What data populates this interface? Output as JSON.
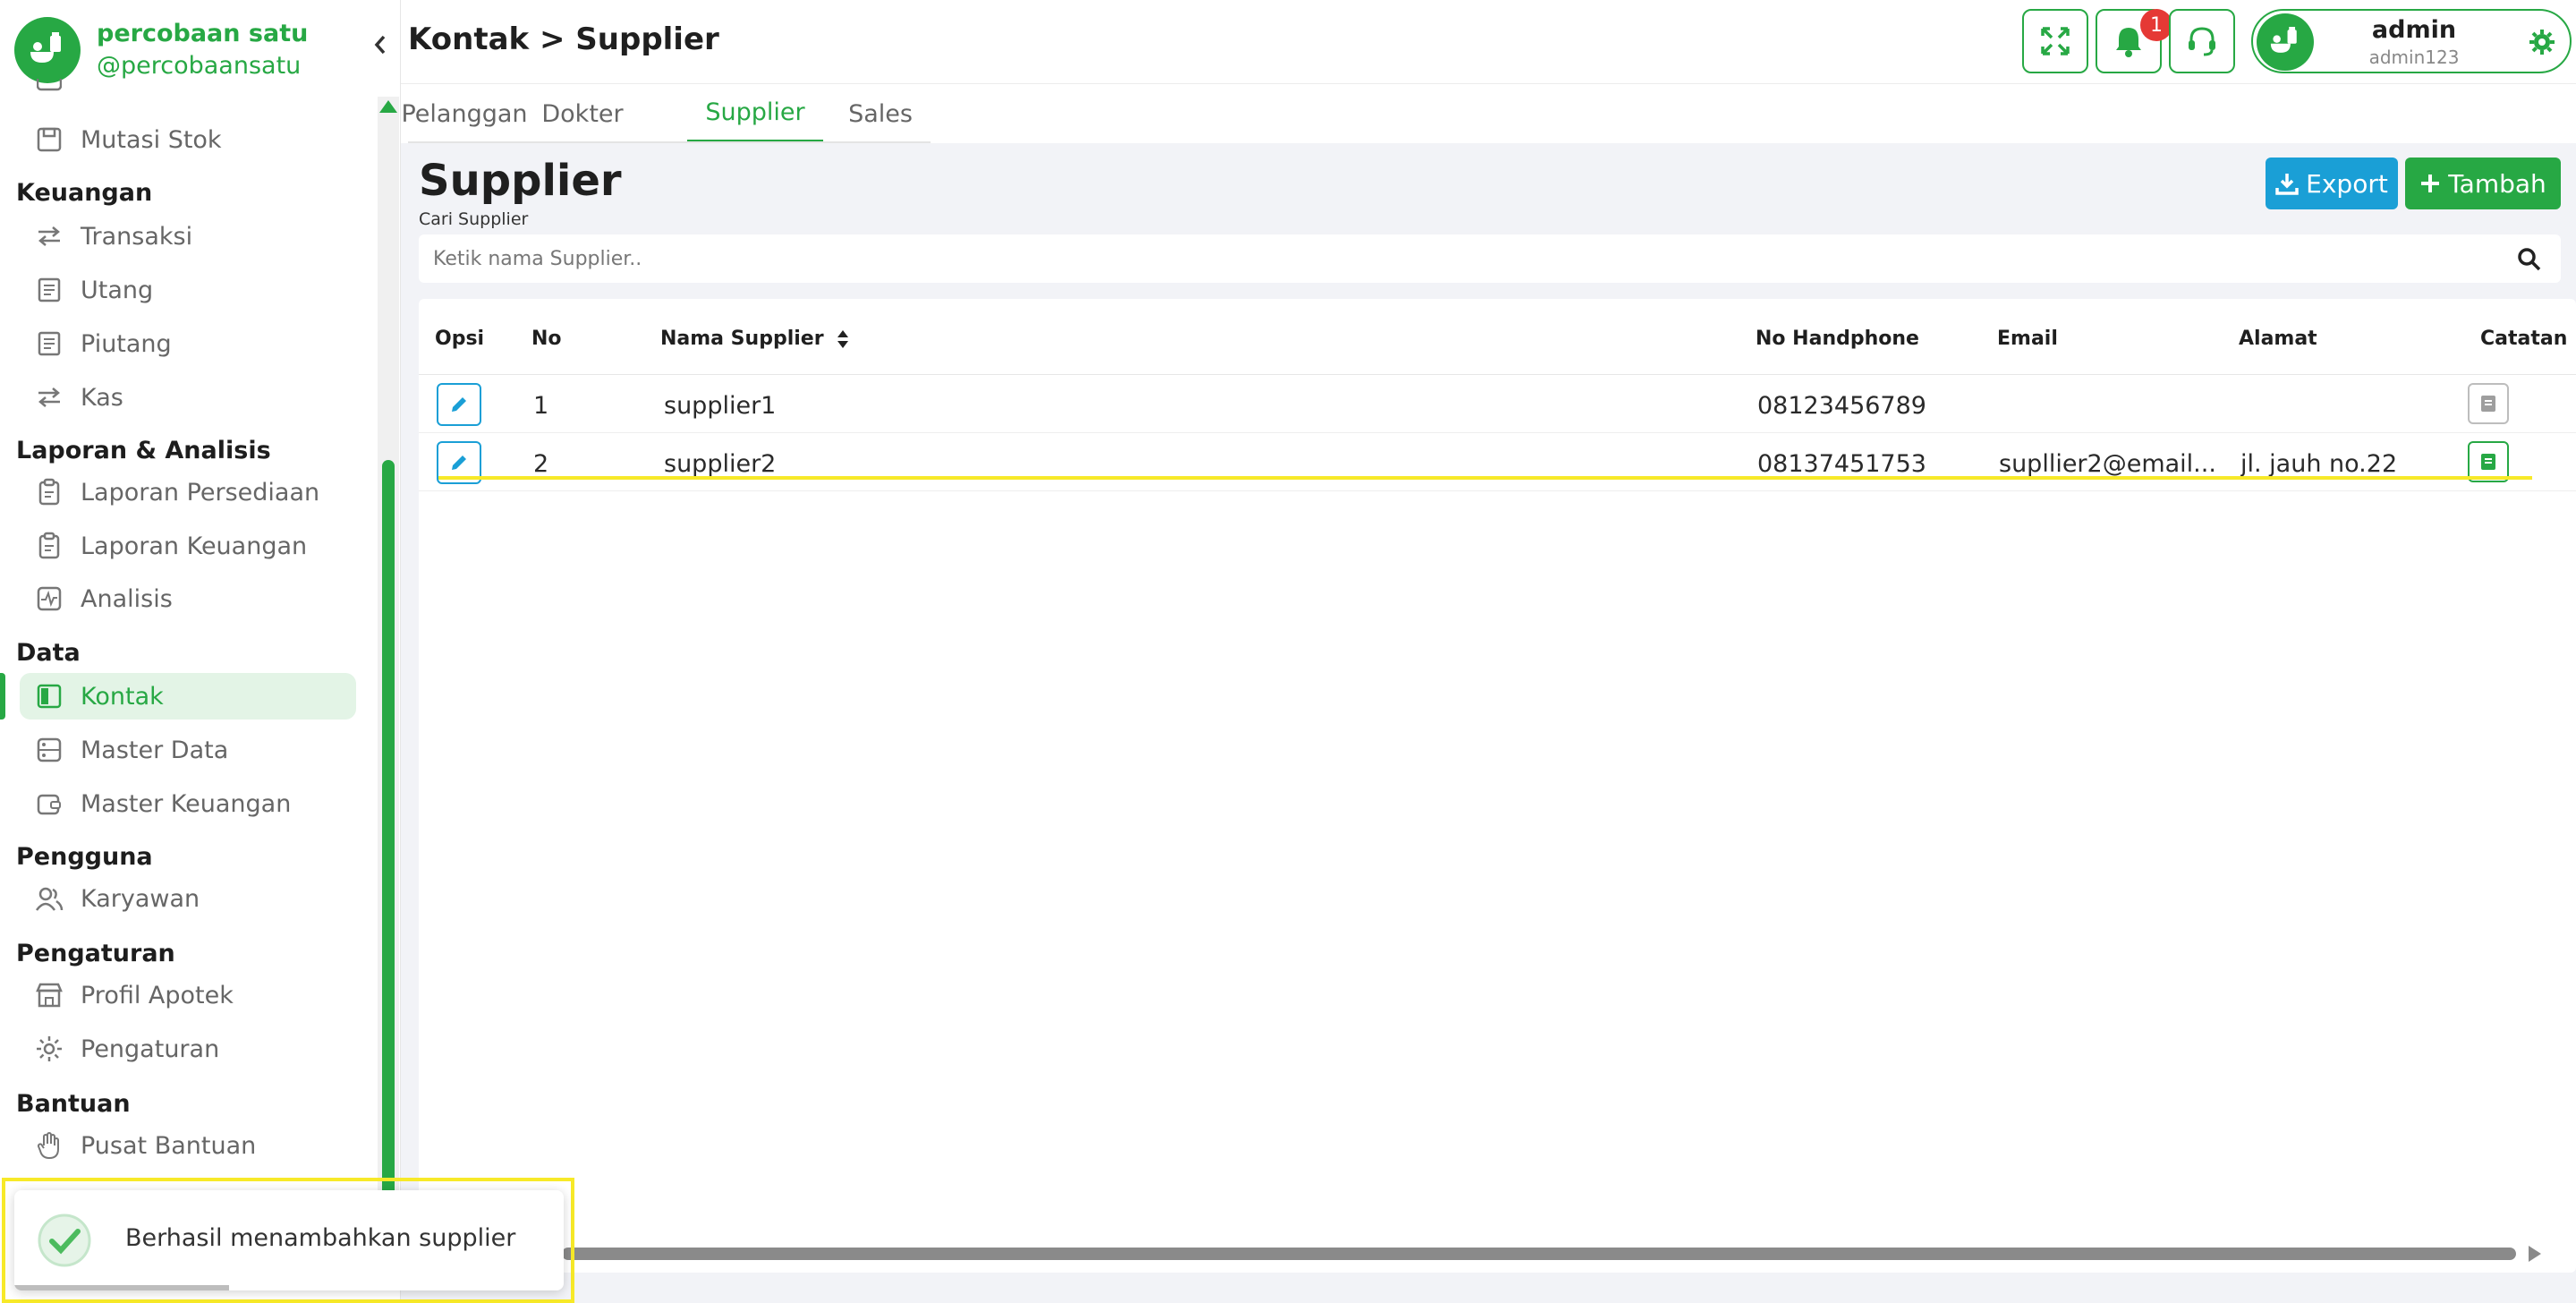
{
  "brand": {
    "name": "percobaan satu",
    "handle": "@percobaansatu"
  },
  "sidebar": {
    "partial_item": "",
    "items": {
      "mutasi_stok": "Mutasi Stok",
      "transaksi": "Transaksi",
      "utang": "Utang",
      "piutang": "Piutang",
      "kas": "Kas",
      "laporan_persediaan": "Laporan Persediaan",
      "laporan_keuangan": "Laporan Keuangan",
      "analisis": "Analisis",
      "kontak": "Kontak",
      "master_data": "Master Data",
      "master_keuangan": "Master Keuangan",
      "karyawan": "Karyawan",
      "profil_apotek": "Profil Apotek",
      "pengaturan": "Pengaturan",
      "pusat_bantuan": "Pusat Bantuan"
    },
    "sections": {
      "keuangan": "Keuangan",
      "laporan": "Laporan & Analisis",
      "data": "Data",
      "pengguna": "Pengguna",
      "pengaturan": "Pengaturan",
      "bantuan": "Bantuan"
    }
  },
  "header": {
    "breadcrumb": "Kontak > Supplier",
    "notification_count": "1",
    "user": {
      "name": "admin",
      "username": "admin123"
    }
  },
  "tabs": [
    "Pelanggan",
    "Dokter",
    "Supplier",
    "Sales"
  ],
  "page": {
    "title": "Supplier",
    "search_label": "Cari Supplier",
    "search_placeholder": "Ketik nama Supplier..",
    "export_label": "Export",
    "add_label": "Tambah"
  },
  "table": {
    "columns": {
      "opsi": "Opsi",
      "no": "No",
      "nama": "Nama Supplier",
      "hp": "No Handphone",
      "email": "Email",
      "alamat": "Alamat",
      "catatan": "Catatan"
    },
    "rows": [
      {
        "no": "1",
        "nama": "supplier1",
        "hp": "08123456789",
        "email": "",
        "alamat": ""
      },
      {
        "no": "2",
        "nama": "supplier2",
        "hp": "08137451753",
        "email": "supllier2@email....",
        "alamat": "jl. jauh no.22"
      }
    ]
  },
  "toast": {
    "message": "Berhasil menambahkan supplier"
  },
  "colors": {
    "primary": "#27a844",
    "info": "#1a9fd6",
    "badge": "#e53935"
  }
}
